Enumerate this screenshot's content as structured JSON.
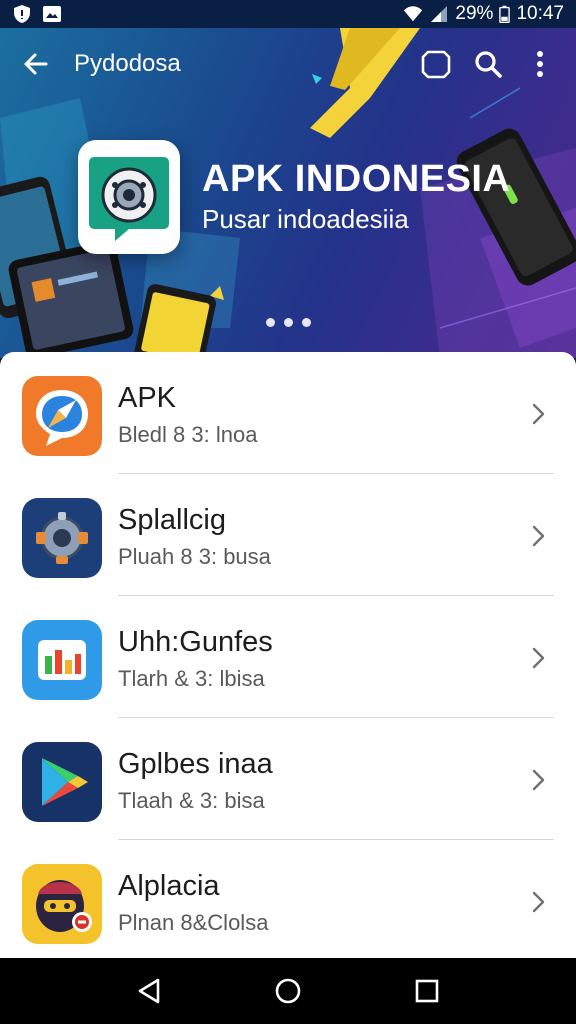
{
  "status_bar": {
    "battery": "29%",
    "time": "10:47",
    "icons": [
      "shield-icon",
      "image-icon",
      "wifi-icon",
      "signal-icon",
      "battery-icon"
    ]
  },
  "toolbar": {
    "title": "Pydodosa",
    "back_icon": "arrow-left-icon",
    "actions": [
      "cube-icon",
      "search-icon",
      "more-vert-icon"
    ]
  },
  "banner": {
    "title": "APK INDONESIA",
    "subtitle": "Pusar indoadesiia",
    "pager_dots": 3
  },
  "apps": [
    {
      "title": "APK",
      "subtitle": "Bledl 8 3: lnoa",
      "icon": "compass-icon",
      "color": "#f07a2a"
    },
    {
      "title": "Splallcig",
      "subtitle": "Pluah 8 3: busa",
      "icon": "gear-icon",
      "color": "#1c3f7a"
    },
    {
      "title": "Uhh:Gunfes",
      "subtitle": "Tlarh & 3: lbisa",
      "icon": "chart-icon",
      "color": "#2f9be8"
    },
    {
      "title": "Gplbes inaa",
      "subtitle": "Tlaah & 3: bisa",
      "icon": "play-icon",
      "color": "#173266"
    },
    {
      "title": "Alplacia",
      "subtitle": "Plnan 8&Clolsa",
      "icon": "ninja-icon",
      "color": "#f4c22b"
    }
  ],
  "nav": [
    "back-icon",
    "home-icon",
    "recents-icon"
  ]
}
